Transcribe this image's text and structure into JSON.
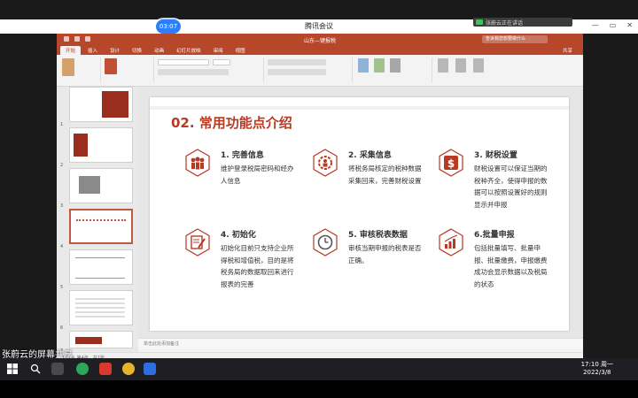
{
  "meeting": {
    "title": "腾讯会议",
    "timer": "03:07",
    "speaker": "张蔚云正在讲话",
    "window_controls": [
      "—",
      "▭",
      "✕"
    ]
  },
  "ppt": {
    "doc_title": "山东—键报税",
    "search_placeholder": "告诉我您想要做什么",
    "tabs": [
      "开始",
      "插入",
      "设计",
      "切换",
      "动画",
      "幻灯片放映",
      "审阅",
      "视图"
    ],
    "active_tab": "开始",
    "share_label": "共享",
    "notes_placeholder": "单击此处添加备注",
    "status_text": "幻灯片 第4张，共7张",
    "thumb_numbers": [
      "1",
      "2",
      "3",
      "4",
      "5",
      "6",
      "7"
    ],
    "active_thumb": 4
  },
  "slide": {
    "title": "02. 常用功能点介绍",
    "features": [
      {
        "title": "1. 完善信息",
        "desc": "维护登录税局密码和经办人信息",
        "icon": "people-icon"
      },
      {
        "title": "2. 采集信息",
        "desc": "将税务局核定的税种数据采集回来，完善财税设置",
        "icon": "gear-person-icon"
      },
      {
        "title": "3. 财税设置",
        "desc": "财税设置可以保证当期的税种齐全，使得申报的数据可以按照设置好的规则显示并申报",
        "icon": "dollar-icon"
      },
      {
        "title": "4. 初始化",
        "desc": "初始化目前只支持企业所得税和增值税，目的是将税务局的数据取回来进行报表的完善",
        "icon": "edit-form-icon"
      },
      {
        "title": "5. 审核税表数据",
        "desc": "审核当期申报的税表是否正确。",
        "icon": "clock-icon"
      },
      {
        "title": "6.批量申报",
        "desc": "包括批量填写、批量申报、批量缴费，申报缴费成功会显示数据以及税局的状态",
        "icon": "bar-chart-icon"
      }
    ]
  },
  "share_label": "张蔚云的屏幕共享",
  "taskbar": {
    "time": "17:10 周一",
    "date": "2022/3/8"
  },
  "colors": {
    "accent": "#b83a23",
    "ppt_red": "#b7472a"
  }
}
